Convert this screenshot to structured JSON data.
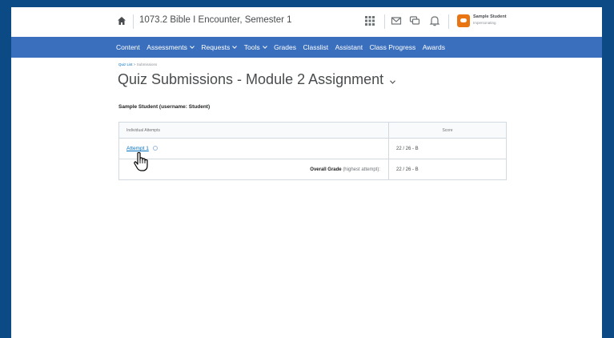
{
  "topbar": {
    "course_title": "1073.2 Bible I Encounter, Semester 1",
    "icons": [
      "home-icon",
      "grid-icon",
      "mail-icon",
      "chat-icon",
      "bell-icon"
    ],
    "user": {
      "name": "Sample Student",
      "role": "Impersonating"
    }
  },
  "navbar": {
    "items": [
      {
        "label": "Content",
        "dropdown": false
      },
      {
        "label": "Assessments",
        "dropdown": true
      },
      {
        "label": "Requests",
        "dropdown": true
      },
      {
        "label": "Tools",
        "dropdown": true
      },
      {
        "label": "Grades",
        "dropdown": false
      },
      {
        "label": "Classlist",
        "dropdown": false
      },
      {
        "label": "Assistant",
        "dropdown": false
      },
      {
        "label": "Class Progress",
        "dropdown": false
      },
      {
        "label": "Awards",
        "dropdown": false
      }
    ]
  },
  "breadcrumb": {
    "link": "Quiz List",
    "separator": ">",
    "current": "Submissions"
  },
  "page": {
    "title": "Quiz Submissions - Module 2 Assignment",
    "user_heading": "Sample Student (username: Student)"
  },
  "table": {
    "headers": [
      "Individual Attempts",
      "Score"
    ],
    "attempt": {
      "label": "Attempt 1",
      "score": "22 / 26 - B"
    },
    "overall": {
      "label": "Overall Grade",
      "note": "(highest attempt):",
      "score": "22 / 26 - B"
    }
  },
  "colors": {
    "background": "#0b4a85",
    "navbar": "#3a6fbe",
    "link": "#006fbf",
    "user_badge": "#e87511"
  }
}
